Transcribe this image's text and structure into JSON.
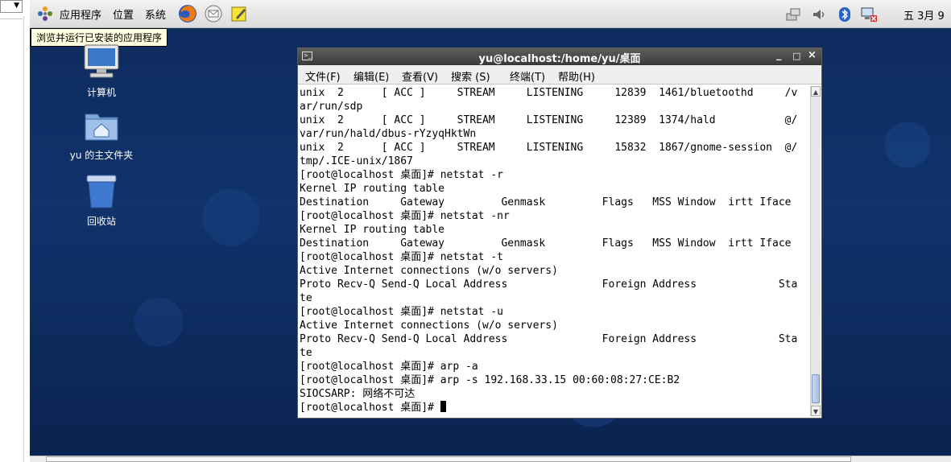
{
  "panel": {
    "menu": [
      "应用程序",
      "位置",
      "系统"
    ],
    "clock": "五 3月  9",
    "launchers": [
      "firefox-icon",
      "mail-icon",
      "notes-icon"
    ],
    "tray": [
      "network-icon",
      "volume-icon",
      "bluetooth-icon",
      "network-status-icon"
    ]
  },
  "tooltip": "浏览并运行已安装的应用程序",
  "desktop_icons": [
    {
      "label": "计算机"
    },
    {
      "label": "yu 的主文件夹"
    },
    {
      "label": "回收站"
    }
  ],
  "terminal": {
    "title": "yu@localhost:/home/yu/桌面",
    "menu": [
      "文件(F)",
      "编辑(E)",
      "查看(V)",
      "搜索 (S)",
      "终端(T)",
      "帮助(H)"
    ],
    "lines": [
      "unix  2      [ ACC ]     STREAM     LISTENING     12839  1461/bluetoothd     /v",
      "ar/run/sdp",
      "unix  2      [ ACC ]     STREAM     LISTENING     12389  1374/hald           @/",
      "var/run/hald/dbus-rYzyqHktWn",
      "unix  2      [ ACC ]     STREAM     LISTENING     15832  1867/gnome-session  @/",
      "tmp/.ICE-unix/1867",
      "[root@localhost 桌面]# netstat -r",
      "Kernel IP routing table",
      "Destination     Gateway         Genmask         Flags   MSS Window  irtt Iface",
      "[root@localhost 桌面]# netstat -nr",
      "Kernel IP routing table",
      "Destination     Gateway         Genmask         Flags   MSS Window  irtt Iface",
      "[root@localhost 桌面]# netstat -t",
      "Active Internet connections (w/o servers)",
      "Proto Recv-Q Send-Q Local Address               Foreign Address             Sta",
      "te",
      "[root@localhost 桌面]# netstat -u",
      "Active Internet connections (w/o servers)",
      "Proto Recv-Q Send-Q Local Address               Foreign Address             Sta",
      "te",
      "[root@localhost 桌面]# arp -a",
      "[root@localhost 桌面]# arp -s 192.168.33.15 00:60:08:27:CE:B2",
      "SIOCSARP: 网络不可达"
    ],
    "prompt": "[root@localhost 桌面]# "
  }
}
